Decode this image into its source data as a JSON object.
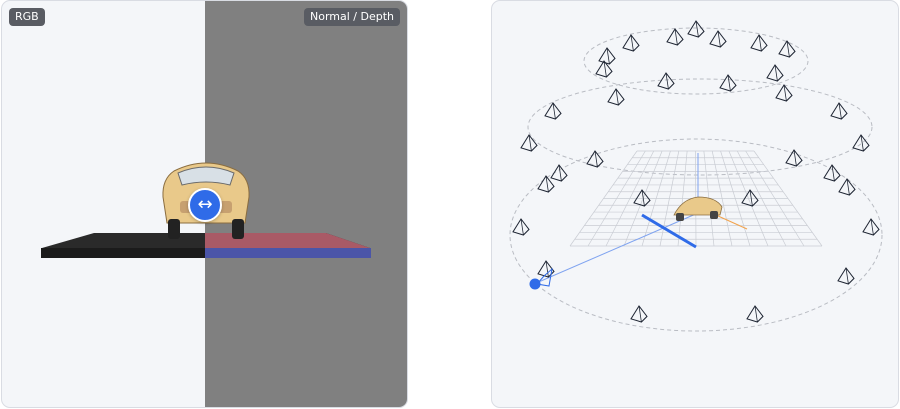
{
  "left_view": {
    "rgb_label": "RGB",
    "normal_depth_label": "Normal / Depth",
    "split_handle_icon": "arrows-left-right-icon",
    "split_position": 0.5,
    "colors": {
      "accent": "#2f6be8",
      "dark_half": "#808080",
      "background": "#f4f6f9"
    }
  },
  "right_view": {
    "description_icons": [
      "camera-frustum-icon",
      "selected-camera-dot"
    ],
    "colors": {
      "grid": "#c9ccd3",
      "axis_blue": "#3a6fe6",
      "axis_orange": "#f2a24a",
      "frustum": "#1e2533"
    }
  }
}
